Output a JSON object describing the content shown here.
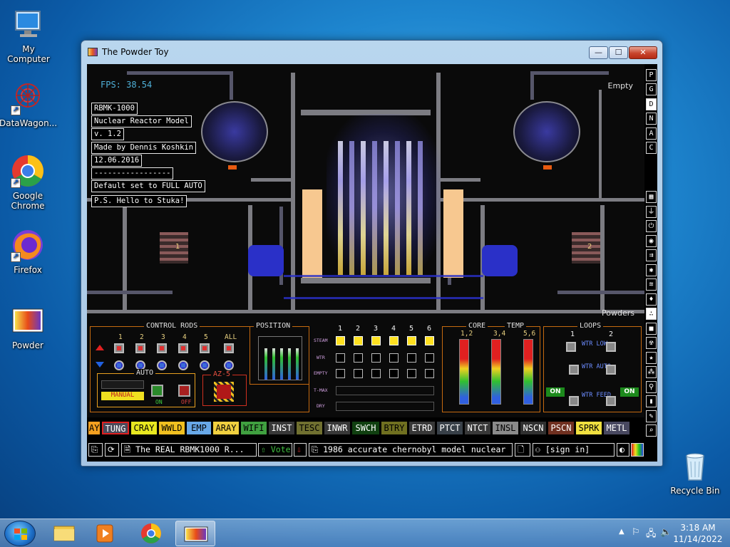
{
  "desktop": {
    "icons": [
      {
        "label": "My Computer"
      },
      {
        "label": "DataWagon..."
      },
      {
        "label": "Google Chrome"
      },
      {
        "label": "Firefox"
      },
      {
        "label": "Powder"
      },
      {
        "label": "Recycle Bin"
      }
    ]
  },
  "window": {
    "title": "The Powder Toy",
    "minimize_glyph": "—",
    "maximize_glyph": "☐",
    "close_glyph": "✕"
  },
  "sim": {
    "fps": "FPS: 38.54",
    "empty_label": "Empty",
    "powders_label": "Powders",
    "info_lines": [
      "RBMK-1000",
      "Nuclear Reactor Model",
      "v. 1.2",
      "Made by Dennis Koshkin",
      "12.06.2016",
      "-----------------",
      "Default set to FULL AUTO",
      "P.S. Hello to Stuka!"
    ],
    "loop_left": "1",
    "loop_right": "2"
  },
  "panel": {
    "control_rods_title": "CONTROL RODS",
    "rod_numbers": [
      "1",
      "2",
      "3",
      "4",
      "5",
      "ALL"
    ],
    "position_title": "POSITION",
    "auto_title": "AUTO",
    "manual_label": "MANUAL",
    "on_label": "ON",
    "off_label": "OFF",
    "az5_title": "AZ-5",
    "steam_numbers": [
      "1",
      "2",
      "3",
      "4",
      "5",
      "6"
    ],
    "row_labels": [
      "STEAM",
      "WTR",
      "EMPTY",
      "T-MAX",
      "DRY"
    ],
    "core_title": "CORE",
    "temp_title": "TEMP",
    "core_groups": [
      "1,2",
      "3,4",
      "5,6"
    ],
    "loops_title": "LOOPS",
    "loop_numbers": [
      "1",
      "2"
    ],
    "wtr_low": "WTR LOW",
    "wtr_auto": "WTR AUTO",
    "wtr_feed": "WTR FEED",
    "on_button": "ON"
  },
  "toolbar": {
    "top_buttons": [
      "P",
      "G",
      "D",
      "N",
      "A",
      "C"
    ],
    "tool_icons": [
      "wall-icon",
      "electronics-icon",
      "powered-icon",
      "sensors-icon",
      "force-icon",
      "explosives-icon",
      "gas-icon",
      "liquids-icon",
      "powders-icon",
      "solids-icon",
      "radioactive-icon",
      "special-icon",
      "life-icon",
      "tools-icon",
      "favorites-icon",
      "decoration-icon",
      "search-icon"
    ]
  },
  "elements": [
    {
      "label": "AY",
      "bg": "#f4a020",
      "fg": "#000"
    },
    {
      "label": "TUNG",
      "bg": "#4a4a5a",
      "fg": "#fff",
      "selected": true
    },
    {
      "label": "CRAY",
      "bg": "#e8e820",
      "fg": "#000"
    },
    {
      "label": "WWLD",
      "bg": "#f0c020",
      "fg": "#000"
    },
    {
      "label": "EMP",
      "bg": "#68a8e8",
      "fg": "#000"
    },
    {
      "label": "ARAY",
      "bg": "#f0d040",
      "fg": "#000"
    },
    {
      "label": "WIFI",
      "bg": "#40a040",
      "fg": "#000"
    },
    {
      "label": "INST",
      "bg": "#383838",
      "fg": "#fff"
    },
    {
      "label": "TESC",
      "bg": "#707030",
      "fg": "#000"
    },
    {
      "label": "INWR",
      "bg": "#383838",
      "fg": "#fff"
    },
    {
      "label": "SWCH",
      "bg": "#104010",
      "fg": "#fff"
    },
    {
      "label": "BTRY",
      "bg": "#707020",
      "fg": "#000"
    },
    {
      "label": "ETRD",
      "bg": "#383838",
      "fg": "#fff"
    },
    {
      "label": "PTCT",
      "bg": "#384048",
      "fg": "#fff"
    },
    {
      "label": "NTCT",
      "bg": "#383838",
      "fg": "#fff"
    },
    {
      "label": "INSL",
      "bg": "#8a8a8a",
      "fg": "#000"
    },
    {
      "label": "NSCN",
      "bg": "#303030",
      "fg": "#fff"
    },
    {
      "label": "PSCN",
      "bg": "#703020",
      "fg": "#fff"
    },
    {
      "label": "SPRK",
      "bg": "#f0e040",
      "fg": "#000"
    },
    {
      "label": "METL",
      "bg": "#484860",
      "fg": "#fff"
    }
  ],
  "bottom": {
    "save_name": "The REAL RBMK1000 R...",
    "vote_label": "Vote",
    "description": "1986 accurate chernobyl model nuclear ...",
    "sign_in": "[sign in]",
    "pause_glyph": "❚❚"
  },
  "taskbar": {
    "time": "3:18 AM",
    "date": "11/14/2022"
  },
  "colors": {
    "panel_frame": "#c66a10",
    "steam_indicator": "#ffe020",
    "fps_text": "#4fb0d8"
  }
}
